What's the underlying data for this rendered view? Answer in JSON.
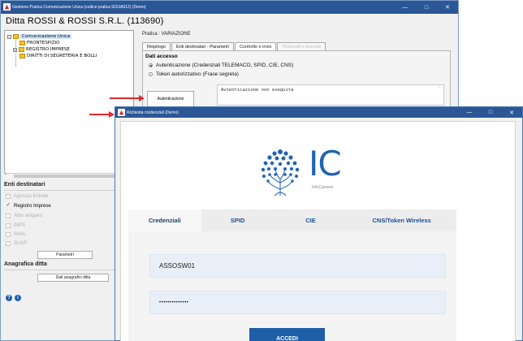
{
  "main_window": {
    "title": "Gestione Pratica Comunicazione Unica (codice pratica 915JA012) (Demo)",
    "heading": "Ditta ROSSI & ROSSI S.R.L. (113690)",
    "tree": {
      "root": "Comunicazione Unica",
      "items": [
        "FRONTESPIZIO",
        "REGISTRO IMPRESE",
        "DIRITTI DI SEGRETERIA E BOLLI"
      ]
    },
    "enti": {
      "label": "Enti destinatari",
      "items": [
        {
          "label": "Agenzia Entrate",
          "checked": false,
          "enabled": false
        },
        {
          "label": "Registro Imprese",
          "checked": true,
          "enabled": true
        },
        {
          "label": "Albo artigiani",
          "checked": false,
          "enabled": false
        },
        {
          "label": "INPS",
          "checked": false,
          "enabled": false
        },
        {
          "label": "INAIL",
          "checked": false,
          "enabled": false
        },
        {
          "label": "SUAP",
          "checked": false,
          "enabled": false
        }
      ],
      "params_button": "Parametri"
    },
    "anagrafica": {
      "label": "Anagrafica ditta",
      "button": "Dati anagrafici ditta"
    },
    "pratica": "Pratica : VARIAZIONE",
    "tabs": [
      {
        "label": "Riepilogo",
        "state": "normal"
      },
      {
        "label": "Enti destinatari - Parametri",
        "state": "normal"
      },
      {
        "label": "Controllo e invio",
        "state": "active"
      },
      {
        "label": "Protocolli e ricevute",
        "state": "disabled"
      }
    ],
    "dati_accesso": {
      "label": "Dati accesso",
      "option1": "Autenticazione (Credenziali TELEMACO, SPID, CIE, CNS)",
      "option2": "Token autorizzativo (Frase segreta)",
      "selected": 1,
      "auth_button": "Autenticazione",
      "status": "Autenticazione non eseguita"
    }
  },
  "login_window": {
    "title": "Richiesta credenziali (Demo)",
    "logo_text": "IC",
    "logo_subtext": "InfoCamere",
    "tabs": [
      {
        "label": "Credenziali",
        "active": true
      },
      {
        "label": "SPID",
        "active": false
      },
      {
        "label": "CIE",
        "active": false
      },
      {
        "label": "CNS/Token Wireless",
        "active": false
      }
    ],
    "username": "ASSOSW01",
    "password_mask": "••••••••••••••",
    "login_button": "ACCEDI"
  },
  "colors": {
    "titlebar": "#2b5797",
    "accent": "#1f5fa8",
    "arrow": "#e22a2a"
  }
}
